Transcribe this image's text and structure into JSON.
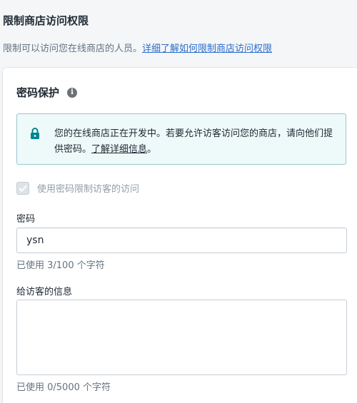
{
  "page": {
    "title": "限制商店访问权限",
    "description": "限制可以访问您在线商店的人员。",
    "learn_more_link": "详细了解如何限制商店访问权限"
  },
  "card": {
    "title": "密码保护",
    "info_icon": "info-icon",
    "banner": {
      "icon": "lock-icon",
      "text": "您的在线商店正在开发中。若要允许访客访问您的商店，请向他们提供密码。",
      "link": "了解详细信息",
      "suffix": "。"
    },
    "checkbox": {
      "label": "使用密码限制访客的访问",
      "checked": true,
      "disabled": true
    },
    "password": {
      "label": "密码",
      "value": "ysn",
      "help": "已使用 3/100 个字符"
    },
    "message": {
      "label": "给访客的信息",
      "value": "",
      "help": "已使用 0/5000 个字符"
    }
  },
  "colors": {
    "link": "#2c6ecb",
    "banner_bg": "#eef9f9",
    "banner_border": "#98c6cd",
    "lock_icon": "#00848e"
  }
}
